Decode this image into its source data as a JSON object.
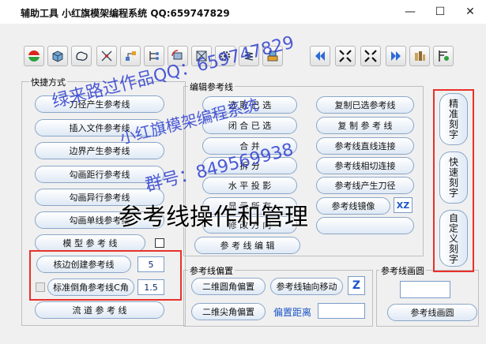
{
  "window": {
    "title": "辅助工具  小红旗模架编程系统  QQ:659747829",
    "controls": [
      "—",
      "☐",
      "✕"
    ]
  },
  "toolbar": {
    "icons": [
      "red-green-circle-icon",
      "cube-icon",
      "blob-outline-icon",
      "wire-node-icon",
      "tree-branch-icon",
      "hierarchy-icon",
      "rotate-part-icon",
      "cube-cross-icon",
      "gear-icon",
      "spring-icon",
      "box-stack-icon",
      "double-left-icon",
      "shrink-corners-icon",
      "expand-corners-icon",
      "double-right-icon",
      "cylinders-icon",
      "caliper-icon"
    ]
  },
  "shortcuts": {
    "label": "快捷方式",
    "buttons": [
      "刀径产生参考线",
      "插入文件参考线",
      "边界产生参考线",
      "勾画距行参考线",
      "勾画异行参考线",
      "勾画单线参考线"
    ],
    "model_ref_btn": "模 型 参 考 线",
    "edge_create_btn": "核边创建参考线",
    "edge_create_value": "5",
    "corner_btn": "标准倒角参考线C角",
    "corner_value": "1.5",
    "flow_btn": "流  道  参  考  线"
  },
  "edit": {
    "label": "编辑参考线",
    "left": [
      "选 取 已 选",
      "闭 合 已 选",
      "合        并",
      "拆        分",
      "水 平 投 影",
      "显 示 所 有",
      "修 改 方 向"
    ],
    "right": [
      "复制已选参考线",
      "复 制 参 考 线",
      "参考线直线连接",
      "参考线相切连接",
      "参考线产生刀径",
      "参考线镜像",
      ""
    ],
    "xz_label": "XZ",
    "edit_btn": "参 考 线 编 辑"
  },
  "offset": {
    "label": "参考线偏置",
    "btn_round": "二维圆角偏置",
    "btn_axial": "参考线轴向移动",
    "z_label": "Z",
    "btn_sharp": "二维尖角偏置",
    "distance_label": "偏置距离",
    "distance_value": ""
  },
  "circle": {
    "label": "参考线画圆",
    "value": "",
    "btn": "参考线画圆"
  },
  "side": {
    "items": [
      "精准刻字",
      "快速刻字",
      "自定义刻字"
    ]
  },
  "watermark": {
    "line1": "绿来路过作品QQ：659747829",
    "line2": "小红旗模架编程系统",
    "line3": "群号：849569938"
  },
  "overlay_caption": "参考线操作和管理"
}
